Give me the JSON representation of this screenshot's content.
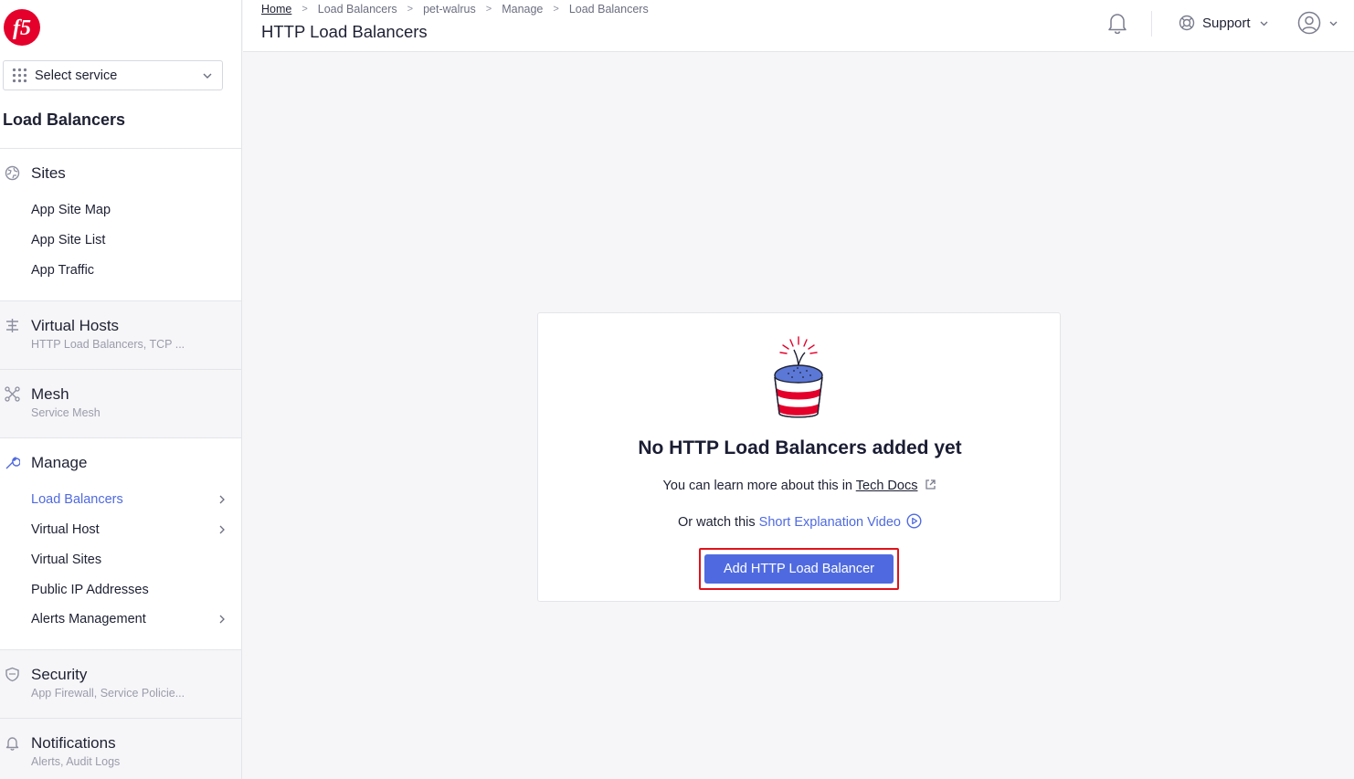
{
  "sidebar": {
    "service_selector": {
      "label": "Select service"
    },
    "title": "Load Balancers",
    "sections": {
      "sites": {
        "label": "Sites",
        "items": [
          "App Site Map",
          "App Site List",
          "App Traffic"
        ]
      },
      "virtual_hosts": {
        "label": "Virtual Hosts",
        "subtitle": "HTTP Load Balancers, TCP ..."
      },
      "mesh": {
        "label": "Mesh",
        "subtitle": "Service Mesh"
      },
      "manage": {
        "label": "Manage",
        "items": [
          "Load Balancers",
          "Virtual Host",
          "Virtual Sites",
          "Public IP Addresses",
          "Alerts Management"
        ],
        "active_item": "Load Balancers"
      },
      "security": {
        "label": "Security",
        "subtitle": "App Firewall, Service Policie..."
      },
      "notifications": {
        "label": "Notifications",
        "subtitle": "Alerts, Audit Logs"
      }
    }
  },
  "header": {
    "breadcrumb": [
      "Home",
      "Load Balancers",
      "pet-walrus",
      "Manage",
      "Load Balancers"
    ],
    "breadcrumb_sep": ">",
    "title": "HTTP Load Balancers",
    "support_label": "Support"
  },
  "empty_state": {
    "title": "No HTTP Load Balancers added yet",
    "learn_prefix": "You can learn more about this in ",
    "learn_link": "Tech Docs",
    "watch_prefix": "Or watch this ",
    "watch_link": "Short Explanation Video",
    "button_label": "Add HTTP Load Balancer"
  },
  "icons": {
    "logo": "f5-logo",
    "bell": "bell-icon",
    "support": "lifebuoy-icon",
    "user": "user-circle-icon"
  },
  "colors": {
    "accent": "#4f6ae0",
    "highlight": "#e0121b",
    "brand": "#e4002b"
  }
}
